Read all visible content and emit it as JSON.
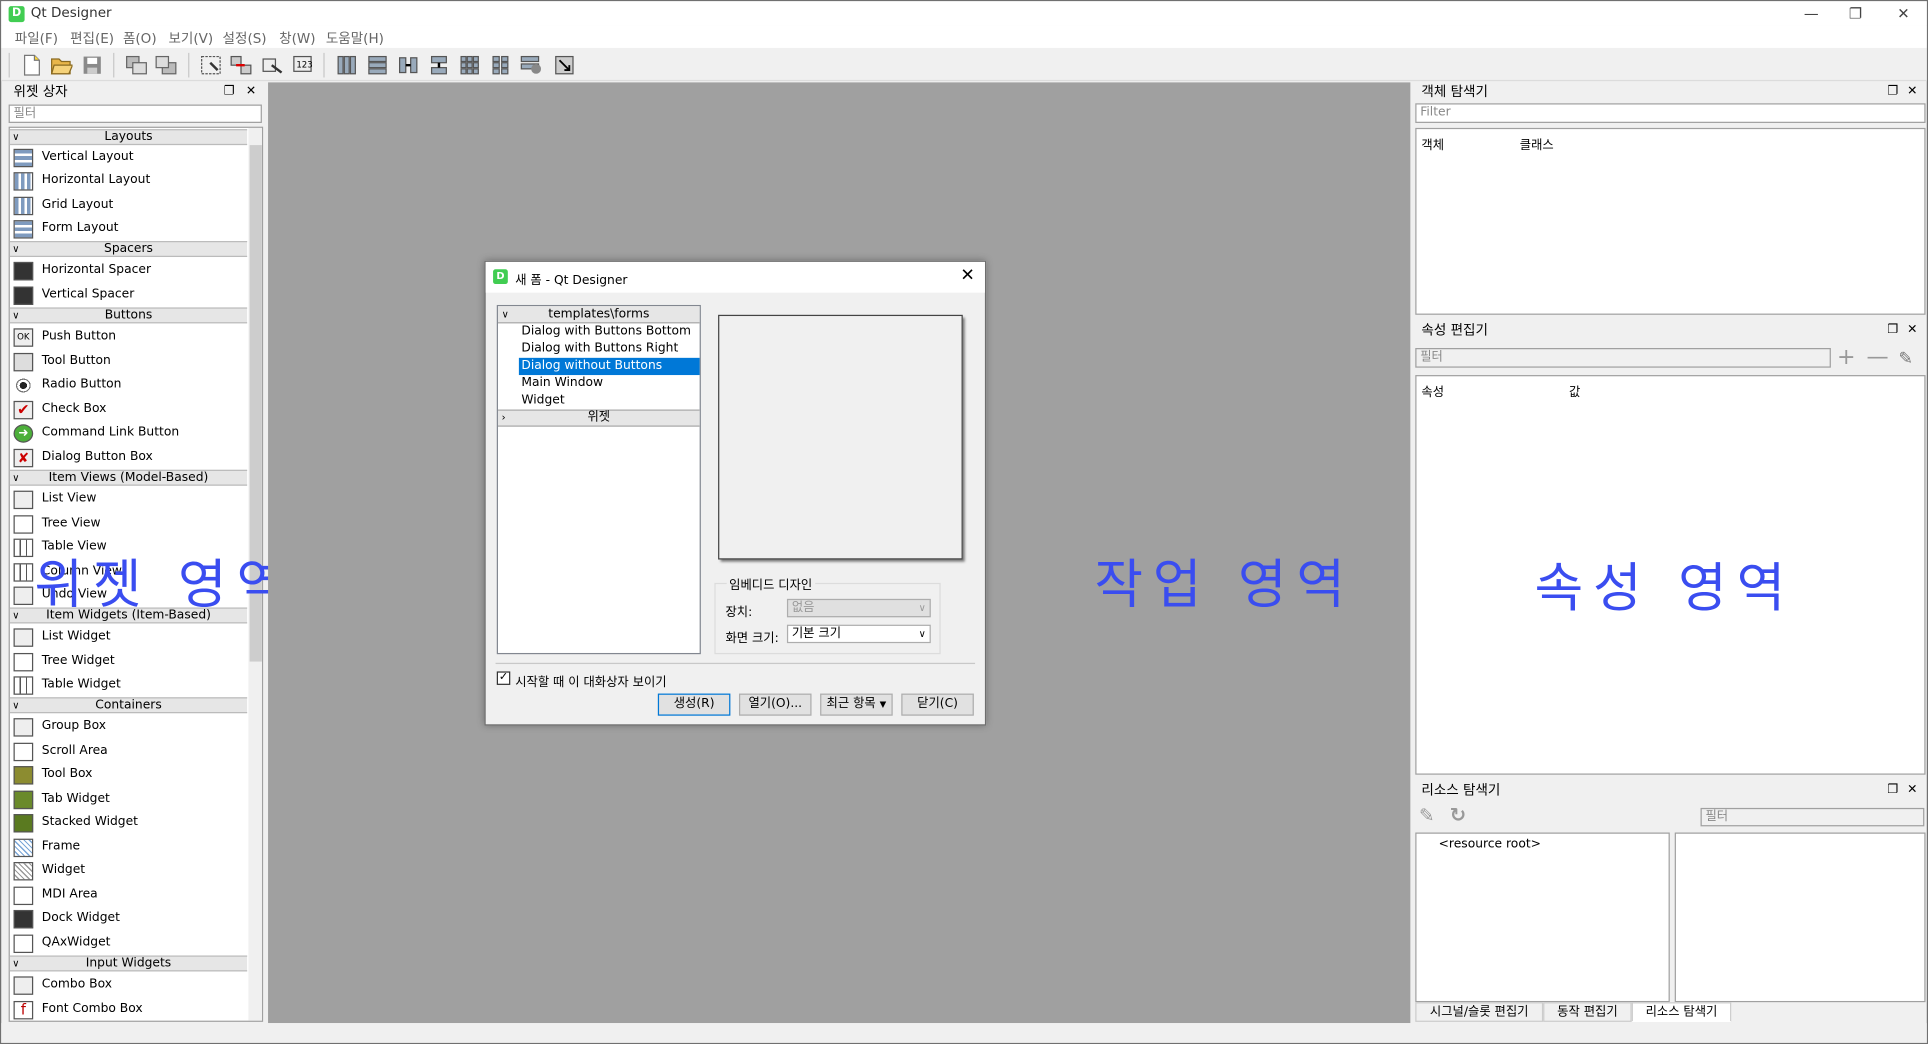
{
  "window": {
    "title": "Qt Designer",
    "app_icon": "D"
  },
  "menu": [
    "파일(F)",
    "편집(E)",
    "폼(O)",
    "보기(V)",
    "설정(S)",
    "창(W)",
    "도움말(H)"
  ],
  "widget_box": {
    "title": "위젯 상자",
    "filter_placeholder": "필터",
    "categories": {
      "layouts": "Layouts",
      "spacers": "Spacers",
      "buttons": "Buttons",
      "item_views": "Item Views (Model-Based)",
      "item_widgets": "Item Widgets (Item-Based)",
      "containers": "Containers",
      "input_widgets": "Input Widgets"
    },
    "items": {
      "vertical_layout": "Vertical Layout",
      "horizontal_layout": "Horizontal Layout",
      "grid_layout": "Grid Layout",
      "form_layout": "Form Layout",
      "horizontal_spacer": "Horizontal Spacer",
      "vertical_spacer": "Vertical Spacer",
      "push_button": "Push Button",
      "tool_button": "Tool Button",
      "radio_button": "Radio Button",
      "check_box": "Check Box",
      "command_link_button": "Command Link Button",
      "dialog_button_box": "Dialog Button Box",
      "list_view": "List View",
      "tree_view": "Tree View",
      "table_view": "Table View",
      "column_view": "Column View",
      "undo_view": "Undo View",
      "list_widget": "List Widget",
      "tree_widget": "Tree Widget",
      "table_widget": "Table Widget",
      "group_box": "Group Box",
      "scroll_area": "Scroll Area",
      "tool_box": "Tool Box",
      "tab_widget": "Tab Widget",
      "stacked_widget": "Stacked Widget",
      "frame": "Frame",
      "widget": "Widget",
      "mdi_area": "MDI Area",
      "dock_widget": "Dock Widget",
      "qaxwidget": "QAxWidget",
      "combo_box": "Combo Box",
      "font_combo_box": "Font Combo Box"
    }
  },
  "overlays": {
    "widget_area": "위젯 영역",
    "work_area": "작업 영역",
    "property_area": "속성 영역"
  },
  "dialog": {
    "title": "새 폼 - Qt Designer",
    "tree_header": "templates\\forms",
    "templates": [
      "Dialog with Buttons Bottom",
      "Dialog with Buttons Right",
      "Dialog without Buttons",
      "Main Window",
      "Widget"
    ],
    "selected_index": 2,
    "widgets_group": "위젯",
    "embedded_group": "임베디드 디자인",
    "device_label": "장치:",
    "device_value": "없음",
    "screen_size_label": "화면 크기:",
    "screen_size_value": "기본 크기",
    "show_on_startup": "시작할 때 이 대화상자 보이기",
    "btn_create": "생성(R)",
    "btn_open": "열기(O)...",
    "btn_recent": "최근 항목",
    "btn_close": "닫기(C)"
  },
  "object_inspector": {
    "title": "객체 탐색기",
    "filter_placeholder": "Filter",
    "col_object": "객체",
    "col_class": "클래스"
  },
  "property_editor": {
    "title": "속성 편집기",
    "filter_placeholder": "필터",
    "col_property": "속성",
    "col_value": "값"
  },
  "resource_browser": {
    "title": "리소스 탐색기",
    "filter_placeholder": "필터",
    "root": "<resource root>"
  },
  "bottom_tabs": [
    "시그널/슬롯 편집기",
    "동작 편집기",
    "리소스 탐색기"
  ],
  "colors": {
    "selection": "#0078d7",
    "workspace": "#a0a0a0",
    "overlay_text": "#3a4df0"
  }
}
